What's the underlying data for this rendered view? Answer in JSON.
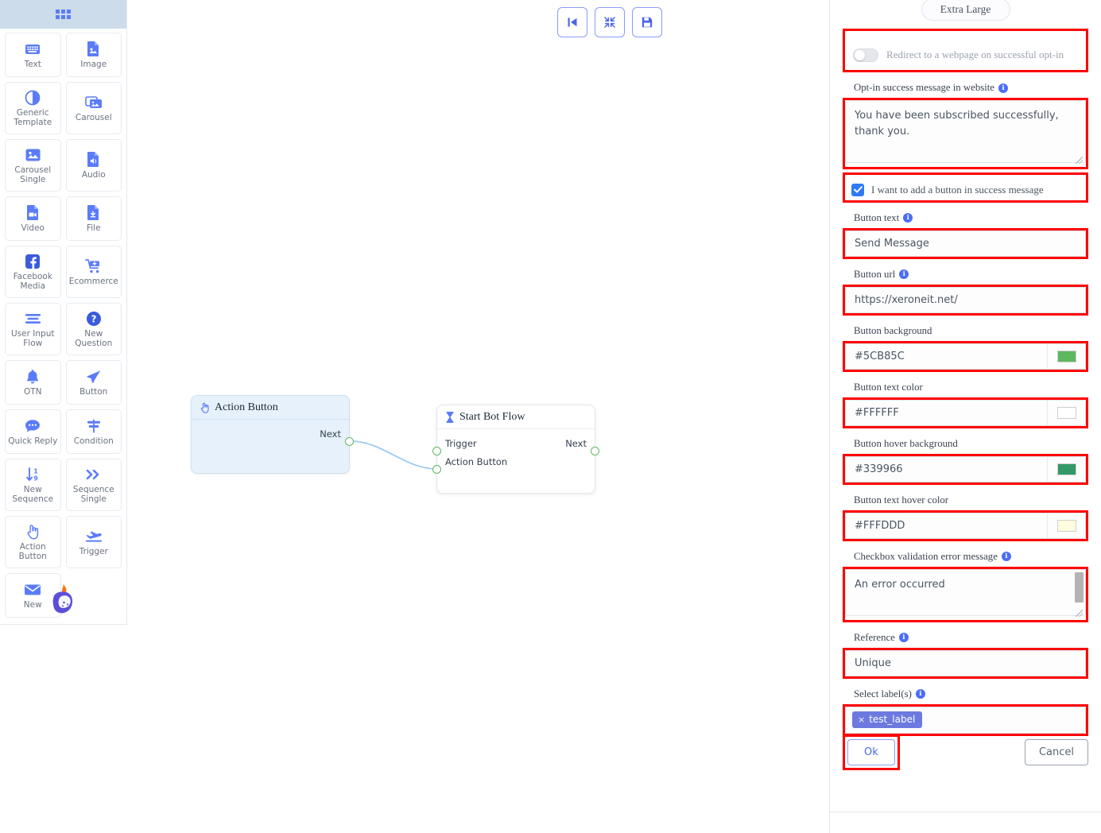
{
  "sidebar": {
    "header_icon": "grid-apps-icon",
    "items": [
      {
        "label": "Text",
        "icon": "keyboard-icon"
      },
      {
        "label": "Image",
        "icon": "image-file-icon"
      },
      {
        "label": "Generic Template",
        "icon": "half-circle-icon"
      },
      {
        "label": "Carousel",
        "icon": "images-stack-icon"
      },
      {
        "label": "Carousel Single",
        "icon": "single-image-icon"
      },
      {
        "label": "Audio",
        "icon": "audio-file-icon"
      },
      {
        "label": "Video",
        "icon": "video-file-icon"
      },
      {
        "label": "File",
        "icon": "download-file-icon"
      },
      {
        "label": "Facebook Media",
        "icon": "facebook-icon"
      },
      {
        "label": "Ecommerce",
        "icon": "shopping-cart-icon"
      },
      {
        "label": "User Input Flow",
        "icon": "lines-list-icon"
      },
      {
        "label": "New Question",
        "icon": "question-mark-icon"
      },
      {
        "label": "OTN",
        "icon": "bell-icon"
      },
      {
        "label": "Button",
        "icon": "send-paper-plane-icon"
      },
      {
        "label": "Quick Reply",
        "icon": "chat-bubble-icon"
      },
      {
        "label": "Condition",
        "icon": "signpost-icon"
      },
      {
        "label": "New Sequence",
        "icon": "sort-numeric-icon"
      },
      {
        "label": "Sequence Single",
        "icon": "double-chevron-right-icon"
      },
      {
        "label": "Action Button",
        "icon": "hand-pointer-icon"
      },
      {
        "label": "Trigger",
        "icon": "plane-takeoff-icon"
      },
      {
        "label": "New",
        "icon": "envelope-icon"
      }
    ],
    "logo": "flame-bot-logo"
  },
  "canvas": {
    "toolbar": [
      {
        "name": "go-to-start",
        "icon": "skip-back-icon"
      },
      {
        "name": "fit-to-screen",
        "icon": "collapse-arrows-icon"
      },
      {
        "name": "save",
        "icon": "floppy-disk-icon"
      }
    ],
    "nodes": [
      {
        "id": "action-button-node",
        "title": "Action Button",
        "icon": "hand-pointer-icon",
        "outputs": [
          "Next"
        ],
        "inputs": []
      },
      {
        "id": "start-bot-flow-node",
        "title": "Start Bot Flow",
        "icon": "hourglass-icon",
        "inputs": [
          "Trigger",
          "Action Button"
        ],
        "outputs": [
          "Next"
        ]
      }
    ]
  },
  "panel": {
    "size_pill": "Extra Large",
    "redirect_toggle": {
      "label": "Redirect to a webpage on successful opt-in",
      "enabled": false
    },
    "optin_message": {
      "label": "Opt-in success message in website",
      "value": "You have been subscribed successfully, thank you."
    },
    "add_button_checkbox": {
      "label": "I want to add a button in success message",
      "checked": true
    },
    "button_text": {
      "label": "Button text",
      "value": "Send Message"
    },
    "button_url": {
      "label": "Button url",
      "value": "https://xeroneit.net/"
    },
    "button_background": {
      "label": "Button background",
      "value": "#5CB85C",
      "swatch": "#5CB85C"
    },
    "button_text_color": {
      "label": "Button text color",
      "value": "#FFFFFF",
      "swatch": "#FFFFFF"
    },
    "button_hover_background": {
      "label": "Button hover background",
      "value": "#339966",
      "swatch": "#339966"
    },
    "button_text_hover_color": {
      "label": "Button text hover color",
      "value": "#FFFDDD",
      "swatch": "#FFFDDD"
    },
    "checkbox_error": {
      "label": "Checkbox validation error message",
      "value": "An error occurred"
    },
    "reference": {
      "label": "Reference",
      "value": "Unique"
    },
    "labels": {
      "label": "Select label(s)",
      "tags": [
        "test_label"
      ]
    },
    "ok_label": "Ok",
    "cancel_label": "Cancel"
  }
}
